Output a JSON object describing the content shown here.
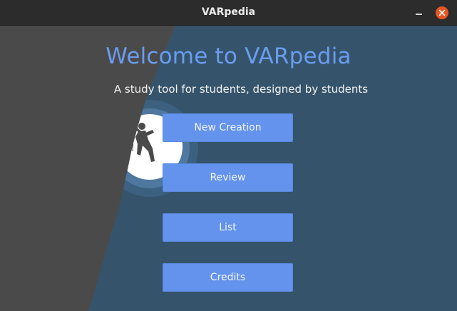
{
  "window": {
    "title": "VARpedia",
    "controls": {
      "minimize_icon": "minimize-icon",
      "close_icon": "close-icon"
    }
  },
  "main": {
    "heading": "Welcome to VARpedia",
    "subheading": "A study tool for students, designed by students",
    "buttons": {
      "new_creation": "New Creation",
      "review": "Review",
      "list": "List",
      "credits": "Credits"
    }
  },
  "colors": {
    "titlebar": "#2c2c2c",
    "background_right": "#35546b",
    "background_left": "#4a4a4a",
    "heading": "#6a9cf0",
    "button": "#6393ec",
    "close_button": "#e95420"
  },
  "illustration": "climber-silhouette-over-moon"
}
